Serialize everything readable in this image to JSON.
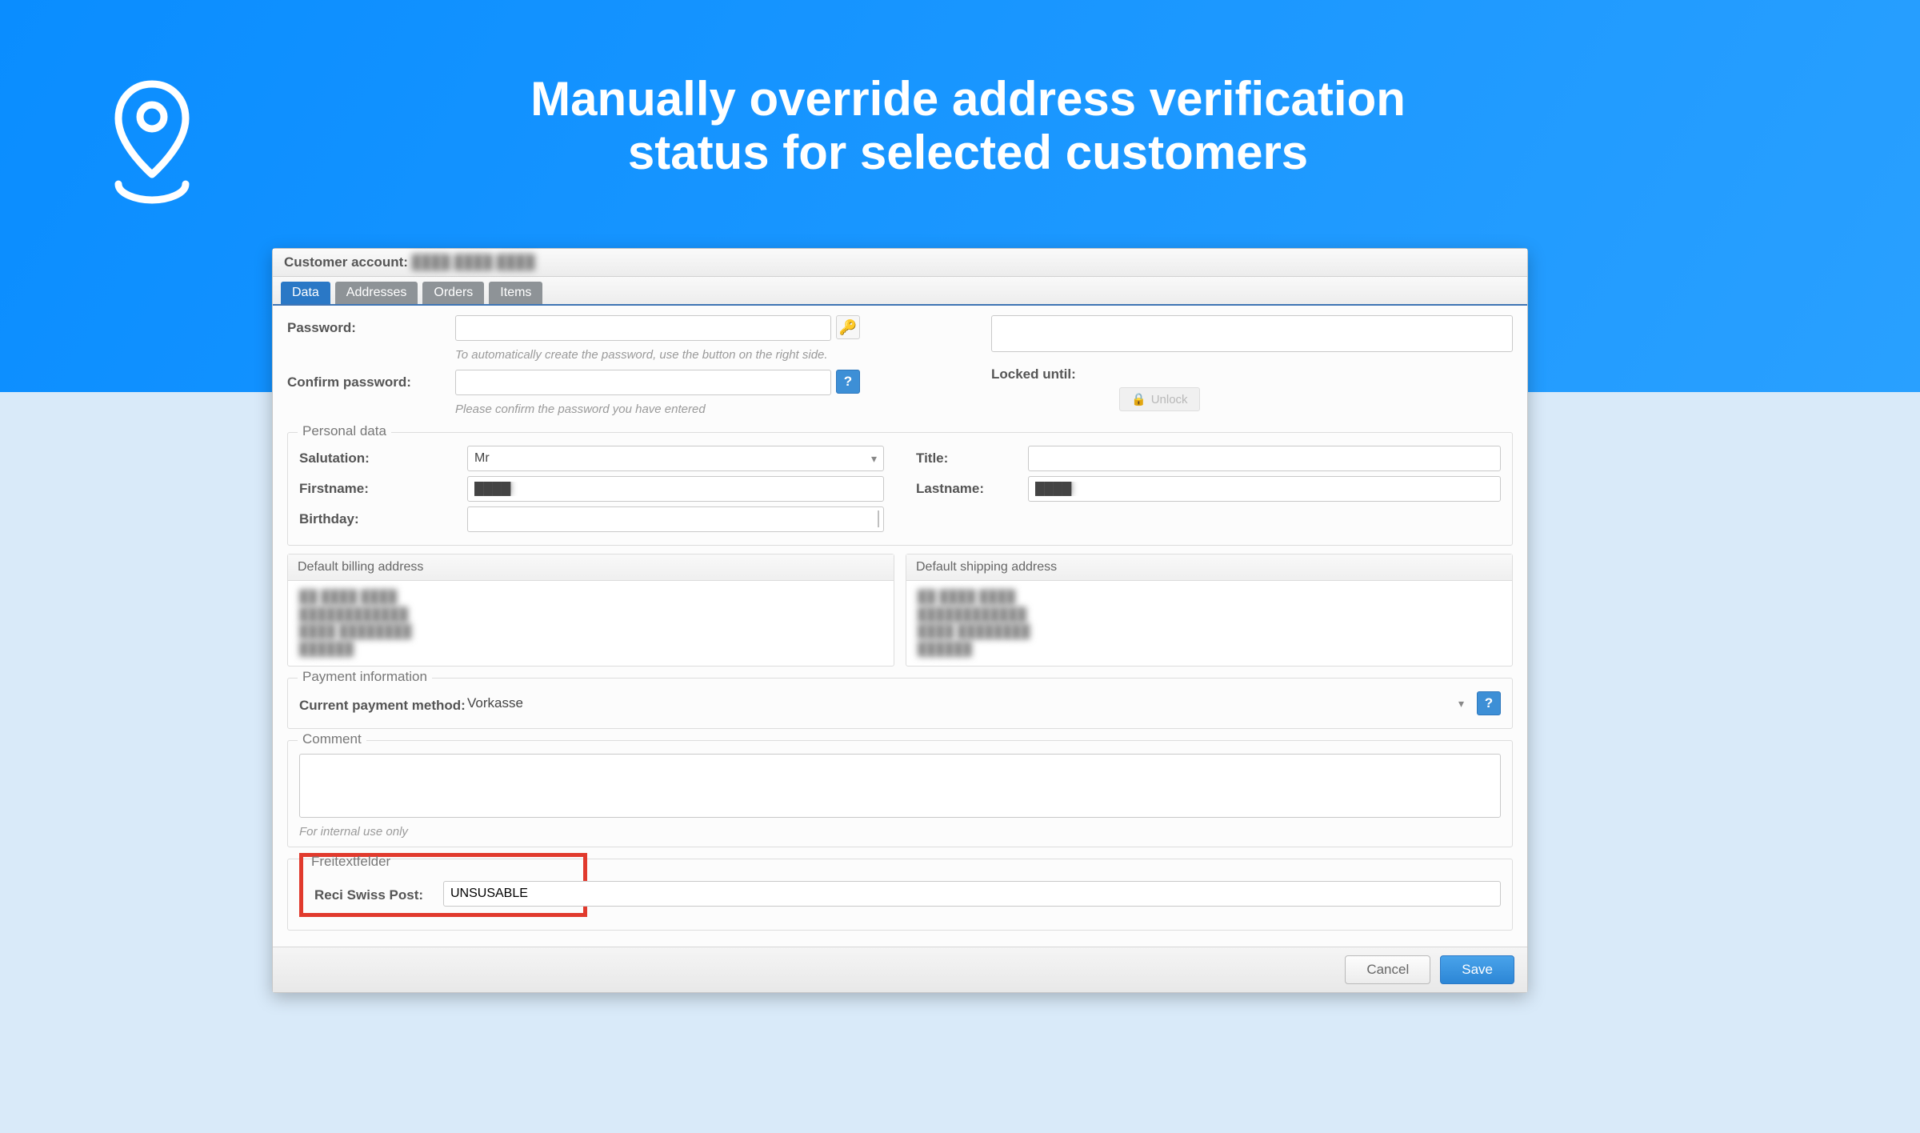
{
  "hero": {
    "title_line1": "Manually override address verification",
    "title_line2": "status for selected customers"
  },
  "window": {
    "title_prefix": "Customer account:",
    "title_name_placeholder": "████ ████ ████"
  },
  "tabs": [
    "Data",
    "Addresses",
    "Orders",
    "Items"
  ],
  "password_section": {
    "password_label": "Password:",
    "password_hint": "To automatically create the password, use the button on the right side.",
    "confirm_label": "Confirm password:",
    "confirm_hint": "Please confirm the password you have entered",
    "locked_until_label": "Locked until:",
    "unlock_label": "Unlock"
  },
  "personal_data": {
    "legend": "Personal data",
    "salutation_label": "Salutation:",
    "salutation_value": "Mr",
    "title_label": "Title:",
    "firstname_label": "Firstname:",
    "firstname_placeholder_blur": "████",
    "lastname_label": "Lastname:",
    "lastname_placeholder_blur": "████",
    "birthday_label": "Birthday:"
  },
  "addresses": {
    "billing_head": "Default billing address",
    "shipping_head": "Default shipping address",
    "blur_line1": "██ ████ ████",
    "blur_line2": "████████████",
    "blur_line3": "████ ████████",
    "blur_line4": "██████"
  },
  "payment": {
    "legend": "Payment information",
    "method_label": "Current payment method:",
    "method_value": "Vorkasse"
  },
  "comment": {
    "legend": "Comment",
    "hint": "For internal use only"
  },
  "freitext": {
    "legend": "Freitextfelder",
    "field_label": "Reci Swiss Post:",
    "field_value": "UNSUSABLE"
  },
  "footer": {
    "cancel": "Cancel",
    "save": "Save"
  }
}
